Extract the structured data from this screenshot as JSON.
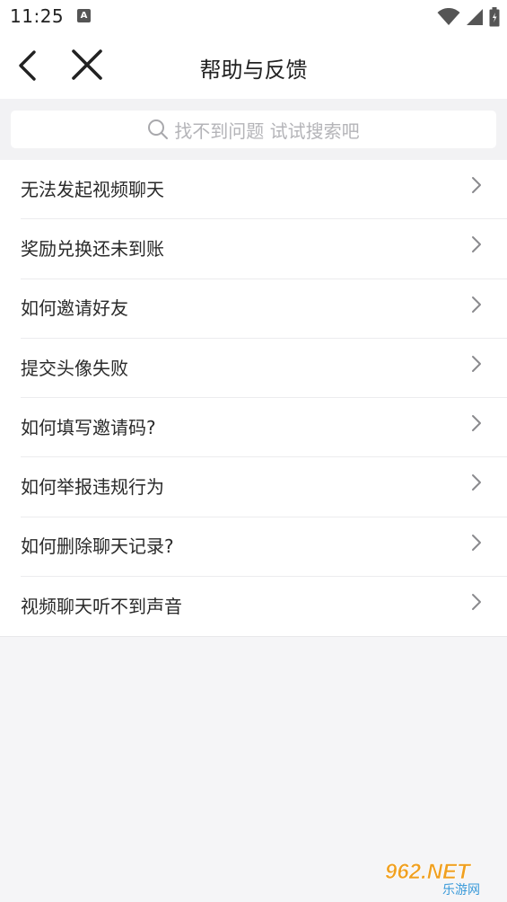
{
  "status_bar": {
    "time": "11:25",
    "notification_icon": "a-notification-icon",
    "icons": [
      "wifi-icon",
      "signal-icon",
      "battery-icon"
    ]
  },
  "header": {
    "title": "帮助与反馈",
    "back_icon": "chevron-left-icon",
    "close_icon": "close-icon"
  },
  "search": {
    "placeholder": "找不到问题 试试搜索吧",
    "icon": "search-icon"
  },
  "faq_items": [
    {
      "label": "无法发起视频聊天"
    },
    {
      "label": "奖励兑换还未到账"
    },
    {
      "label": "如何邀请好友"
    },
    {
      "label": "提交头像失败"
    },
    {
      "label": "如何填写邀请码?"
    },
    {
      "label": "如何举报违规行为"
    },
    {
      "label": "如何删除聊天记录?"
    },
    {
      "label": "视频聊天听不到声音"
    }
  ],
  "watermark": {
    "brand": "962.NET",
    "subtitle": "乐游网"
  },
  "colors": {
    "background": "#f5f5f7",
    "surface": "#ffffff",
    "text_primary": "#222222",
    "placeholder": "#b4b4b8",
    "chevron": "#8a8a8e"
  }
}
